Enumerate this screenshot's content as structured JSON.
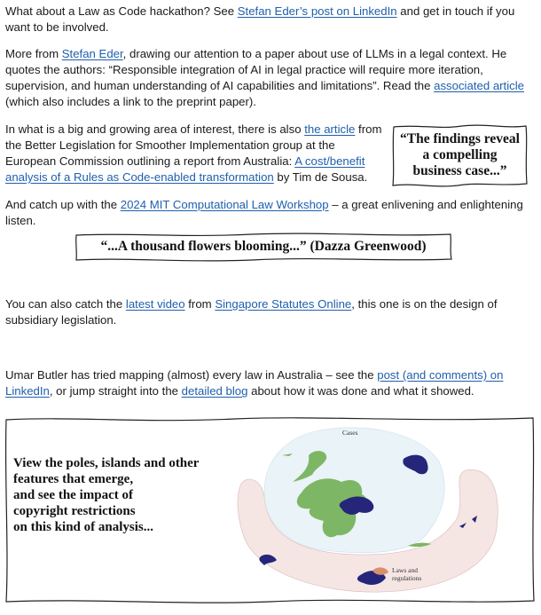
{
  "paragraphs": {
    "p1": {
      "t1": "What about a Law as Code hackathon? See ",
      "link1": "Stefan Eder’s post on LinkedIn",
      "t2": " and get in touch if you want to be involved."
    },
    "p2": {
      "t1": "More from ",
      "link1": "Stefan Eder",
      "t2": ", drawing our attention to a paper about use of LLMs in a legal context. He quotes the authors: “Responsible integration of AI in legal practice will require more iteration, supervision, and human understanding of AI capabilities and limitations”. Read the ",
      "link2": "associated article",
      "t3": " (which also includes a link to the preprint paper)."
    },
    "p3": {
      "t1": "In what is a big and growing area of interest, there is also ",
      "link1": "the article",
      "t2": " from the Better Legislation for Smoother Implementation group at the European Commission outlining a report from Australia: ",
      "link2": "A cost/benefit analysis of a Rules as Code-enabled transformation",
      "t3": " by Tim de Sousa."
    },
    "p4": {
      "t1": "And catch up with the ",
      "link1": "2024 MIT Computational Law Workshop",
      "t2": " – a great enlivening and enlightening listen."
    },
    "p5": {
      "t1": "You can also catch the ",
      "link1": "latest video",
      "t2": " from ",
      "link2": "Singapore Statutes Online",
      "t3": ", this one is on the design of subsidiary legislation."
    },
    "p6": {
      "t1": "Umar Butler has tried mapping (almost) every law in Australia – see the ",
      "link1": "post (and comments) on LinkedIn",
      "t2": ", or jump straight into the ",
      "link2": "detailed blog",
      "t3": " about how it was done and what it showed."
    }
  },
  "callouts": {
    "business_case": [
      "“The findings reveal",
      "a compelling",
      "business case...”"
    ],
    "flowers": "“...A thousand flowers blooming...” (Dazza Greenwood)"
  },
  "map_panel": {
    "caption_lines": [
      "View the poles, islands and other",
      "features that emerge,",
      "and see the impact of",
      "copyright restrictions",
      "on this kind of analysis..."
    ],
    "label_cases": "Cases",
    "label_laws_1": "Laws and",
    "label_laws_2": "regulations",
    "colors": {
      "cases_region": "#eaf3f8",
      "laws_region": "#f5e6e4",
      "cluster_green": "#7db765",
      "cluster_navy": "#25267a",
      "cluster_orange": "#d9906a"
    }
  }
}
